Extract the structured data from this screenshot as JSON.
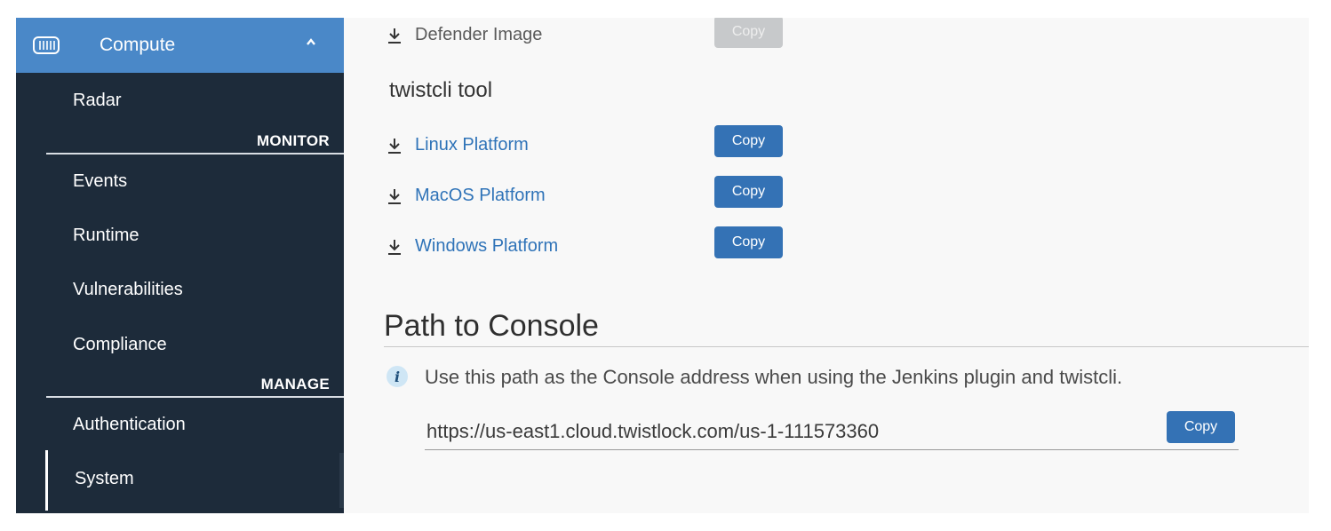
{
  "sidebar": {
    "header": {
      "label": "Compute",
      "icon": "container-icon",
      "chevron": "chevron-up-icon"
    },
    "top_items": [
      {
        "label": "Radar"
      }
    ],
    "sections": [
      {
        "label": "MONITOR",
        "items": [
          {
            "label": "Events"
          },
          {
            "label": "Runtime"
          },
          {
            "label": "Vulnerabilities"
          },
          {
            "label": "Compliance"
          }
        ]
      },
      {
        "label": "MANAGE",
        "items": [
          {
            "label": "Authentication"
          },
          {
            "label": "System"
          }
        ]
      }
    ],
    "active_item": "System"
  },
  "main": {
    "defender_image": {
      "label": "Defender Image",
      "copy_label": "Copy"
    },
    "twistcli": {
      "title": "twistcli tool",
      "downloads": [
        {
          "label": "Linux Platform",
          "copy_label": "Copy"
        },
        {
          "label": "MacOS Platform",
          "copy_label": "Copy"
        },
        {
          "label": "Windows Platform",
          "copy_label": "Copy"
        }
      ]
    },
    "path_to_console": {
      "title": "Path to Console",
      "info": "Use this path as the Console address when using the Jenkins plugin and twistcli.",
      "url": "https://us-east1.cloud.twistlock.com/us-1-111573360",
      "copy_label": "Copy"
    }
  },
  "colors": {
    "sidebar_bg": "#1d2b3a",
    "header_bg": "#4a88c8",
    "link": "#2f73b8",
    "button": "#3472b5",
    "button_disabled": "#c7c9cb"
  }
}
